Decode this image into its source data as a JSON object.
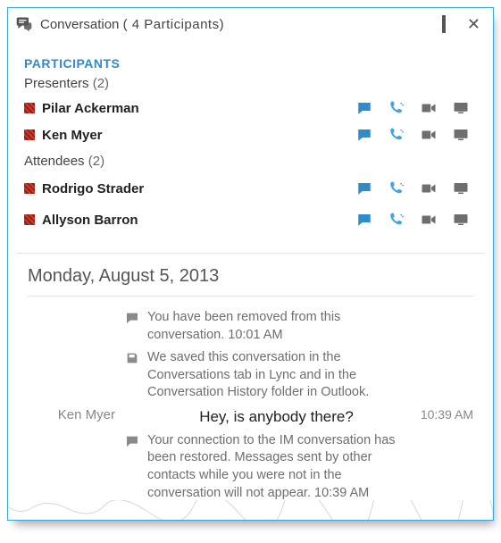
{
  "window": {
    "title_prefix": "Conversation",
    "participants_count_label": "( 4 Participants)"
  },
  "participants": {
    "heading": "PARTICIPANTS",
    "groups": [
      {
        "label": "Presenters",
        "count_label": "(2)",
        "items": [
          {
            "name": "Pilar Ackerman"
          },
          {
            "name": "Ken Myer"
          }
        ]
      },
      {
        "label": "Attendees",
        "count_label": "(2)",
        "items": [
          {
            "name": "Rodrigo Strader"
          },
          {
            "name": "Allyson Barron"
          }
        ]
      }
    ]
  },
  "conversation": {
    "date": "Monday, August 5, 2013",
    "entries": [
      {
        "kind": "system",
        "icon": "chat-icon",
        "text": "You have been removed from this conversation. 10:01 AM"
      },
      {
        "kind": "system",
        "icon": "save-icon",
        "text": "We saved this conversation in the Conversations tab in Lync and in the Conversation History folder in Outlook."
      },
      {
        "kind": "message",
        "sender": "Ken Myer",
        "text": "Hey, is anybody there?",
        "time": "10:39 AM"
      },
      {
        "kind": "system",
        "icon": "chat-icon",
        "text": "Your connection to the IM conversation has been restored. Messages sent by other contacts while you were not in the conversation will not appear. 10:39 AM"
      }
    ]
  },
  "colors": {
    "accent": "#2e8bcc",
    "border": "#3fa5df",
    "muted": "#6e6e6e"
  }
}
